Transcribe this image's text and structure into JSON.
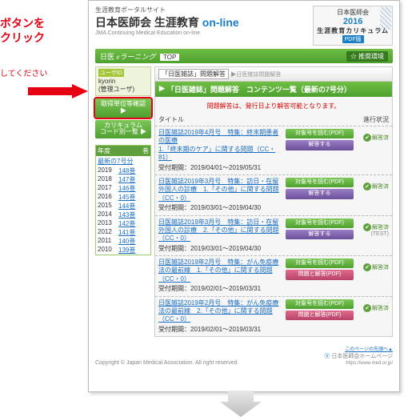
{
  "annotation": {
    "line1": "ボタンを",
    "line2": "クリック",
    "line3": "してください"
  },
  "header": {
    "subtitle": "生涯教育ポータルサイト",
    "title_jp": "日本医師会 生涯教育",
    "title_online": "on-line",
    "title_en": "JMA Continuing Medical Education on-line",
    "right": {
      "org": "日本医師会",
      "year": "2016",
      "line": "生涯教育カリキュラム",
      "pdf": "PDF版"
    }
  },
  "greenbar": {
    "prefix": "日医",
    "elearn": "eラーニング",
    "top": "TOP",
    "right": "☆ 推奨環境"
  },
  "user": {
    "box_label": "ユーザID",
    "id": "kyorin",
    "role": "(管理ユーザ)"
  },
  "side_buttons": {
    "credits": "取得単位等確認 ▶",
    "curriculum": "カリキュラム\nコード別一覧 ▶"
  },
  "year_table": {
    "h1": "年度",
    "h2": "巻",
    "latest": "最新の7号分",
    "rows": [
      {
        "y": "2019",
        "c": "148巻"
      },
      {
        "y": "2018",
        "c": "147巻"
      },
      {
        "y": "2017",
        "c": "146巻"
      },
      {
        "y": "2016",
        "c": "145巻"
      },
      {
        "y": "2015",
        "c": "144巻"
      },
      {
        "y": "2014",
        "c": "143巻"
      },
      {
        "y": "2013",
        "c": "142巻"
      },
      {
        "y": "2012",
        "c": "141巻"
      },
      {
        "y": "2011",
        "c": "140巻"
      },
      {
        "y": "2010",
        "c": "139巻"
      }
    ]
  },
  "breadcrumb": {
    "tag": "「日医雑誌」問題解答",
    "tail": "▶日医雑誌問題解答"
  },
  "main_title": "「日医雑誌」問題解答　コンテンツ一覧（最新の7号分）",
  "notice": "問題解答は、発行日より解答可能となります。",
  "thead": {
    "c1": "タイトル",
    "c3": "進行状況"
  },
  "buttons": {
    "pdf": "対象号を読む(PDF)",
    "answer": "解答する",
    "qa_pdf": "問題と解答(PDF)"
  },
  "status": {
    "done": "解答済",
    "test": "(TEST)"
  },
  "items": [
    {
      "title": "日医雑誌2019年4月号　特集：終末期患者の医療",
      "sub": "1.「終末期のケア」に関する問題（CC・81）",
      "period": "受付期間：2019/04/01～2019/05/31",
      "btns": [
        "pdf",
        "answer"
      ],
      "status": "done"
    },
    {
      "title": "日医雑誌2019年3月号　特集：訪日・在留外国人の診療　1.「その他」に関する問題（CC・0）",
      "sub": "",
      "period": "受付期間：2019/03/01～2019/04/30",
      "btns": [
        "pdf",
        "answer"
      ],
      "status": "done"
    },
    {
      "title": "日医雑誌2019年3月号　特集：訪日・在留外国人の診療　2.「その他」に関する問題（CC・0）",
      "sub": "",
      "period": "受付期間：2019/03/01～2019/04/30",
      "btns": [
        "pdf",
        "answer"
      ],
      "status": "test"
    },
    {
      "title": "日医雑誌2019年2月号　特集：がん免疫療法の最前線　1.「その他」に関する問題（CC・0）",
      "sub": "",
      "period": "受付期間：2019/02/01～2019/03/31",
      "btns": [
        "pdf",
        "qa_pdf"
      ],
      "status": "done"
    },
    {
      "title": "日医雑誌2019年2月号　特集：がん免疫療法の最前線　2.「その他」に関する問題（CC・0）",
      "sub": "",
      "period": "受付期間：2019/02/01～2019/03/31",
      "btns": [
        "pdf",
        "qa_pdf"
      ],
      "status": "done"
    }
  ],
  "footer": {
    "copyright": "Copyright © Japan Medical Association. All right reserved.",
    "top_link": "このページの先頭へ▲",
    "home": "日本医師会ホームページ",
    "url": "https://www.med.or.jp/"
  }
}
